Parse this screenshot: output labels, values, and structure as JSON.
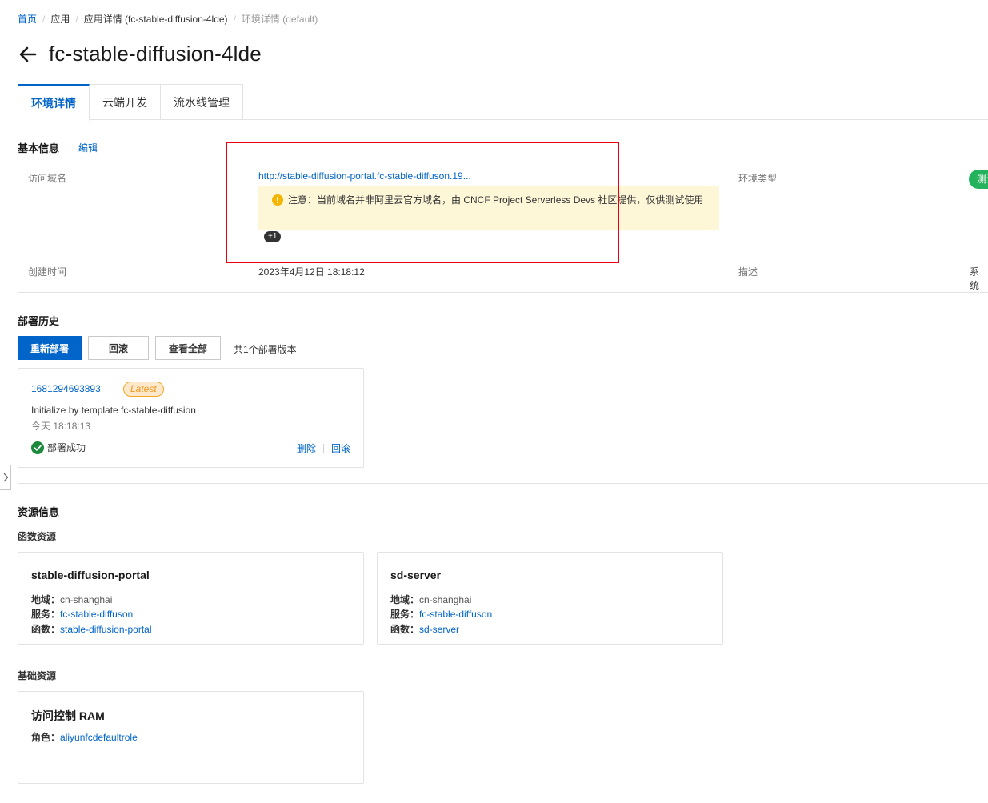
{
  "breadcrumb": {
    "items": [
      "首页",
      "应用",
      "应用详情 (fc-stable-diffusion-4lde)"
    ],
    "current": "环境详情 (default)",
    "separator": "/"
  },
  "header": {
    "title": "fc-stable-diffusion-4lde",
    "back_icon": "arrow-left-icon"
  },
  "tabs": [
    {
      "label": "环境详情",
      "active": true
    },
    {
      "label": "云端开发",
      "active": false
    },
    {
      "label": "流水线管理",
      "active": false
    }
  ],
  "basic_info": {
    "title": "基本信息",
    "edit_label": "编辑",
    "domain_label": "访问域名",
    "domain_value": "http://stable-diffusion-portal.fc-stable-diffuson.19...",
    "notice_icon": "warning-icon",
    "notice_text": "注意：当前域名并非阿里云官方域名，由 CNCF Project Serverless Devs 社区提供，仅供测试使用",
    "more_badge": "+1",
    "env_type_label": "环境类型",
    "env_type_value": "测试",
    "created_label": "创建时间",
    "created_value": "2023年4月12日 18:18:12",
    "desc_label": "描述",
    "desc_value": "系统"
  },
  "deploy_history": {
    "title": "部署历史",
    "redeploy_label": "重新部署",
    "rollback_label": "回滚",
    "view_all_label": "查看全部",
    "count_text": "共1个部署版本",
    "card": {
      "id": "1681294693893",
      "badge": "Latest",
      "description": "Initialize by template fc-stable-diffusion",
      "time": "今天 18:18:13",
      "status_icon": "check-circle-icon",
      "status": "部署成功",
      "delete_label": "删除",
      "rollback_label": "回滚"
    }
  },
  "resources": {
    "title": "资源信息",
    "function_section": "函数资源",
    "functions": [
      {
        "name": "stable-diffusion-portal",
        "region_key": "地域：",
        "region": "cn-shanghai",
        "service_key": "服务：",
        "service": "fc-stable-diffuson",
        "function_key": "函数：",
        "function": "stable-diffusion-portal"
      },
      {
        "name": "sd-server",
        "region_key": "地域：",
        "region": "cn-shanghai",
        "service_key": "服务：",
        "service": "fc-stable-diffuson",
        "function_key": "函数：",
        "function": "sd-server"
      }
    ],
    "base_section": "基础资源",
    "ram": {
      "name": "访问控制 RAM",
      "role_key": "角色：",
      "role": "aliyunfcdefaultrole"
    }
  },
  "colors": {
    "accent": "#0064c8",
    "highlight": "#e60012",
    "success": "#24b35c",
    "notice_bg": "#fdf6d7",
    "latest": "#f29b1f"
  }
}
